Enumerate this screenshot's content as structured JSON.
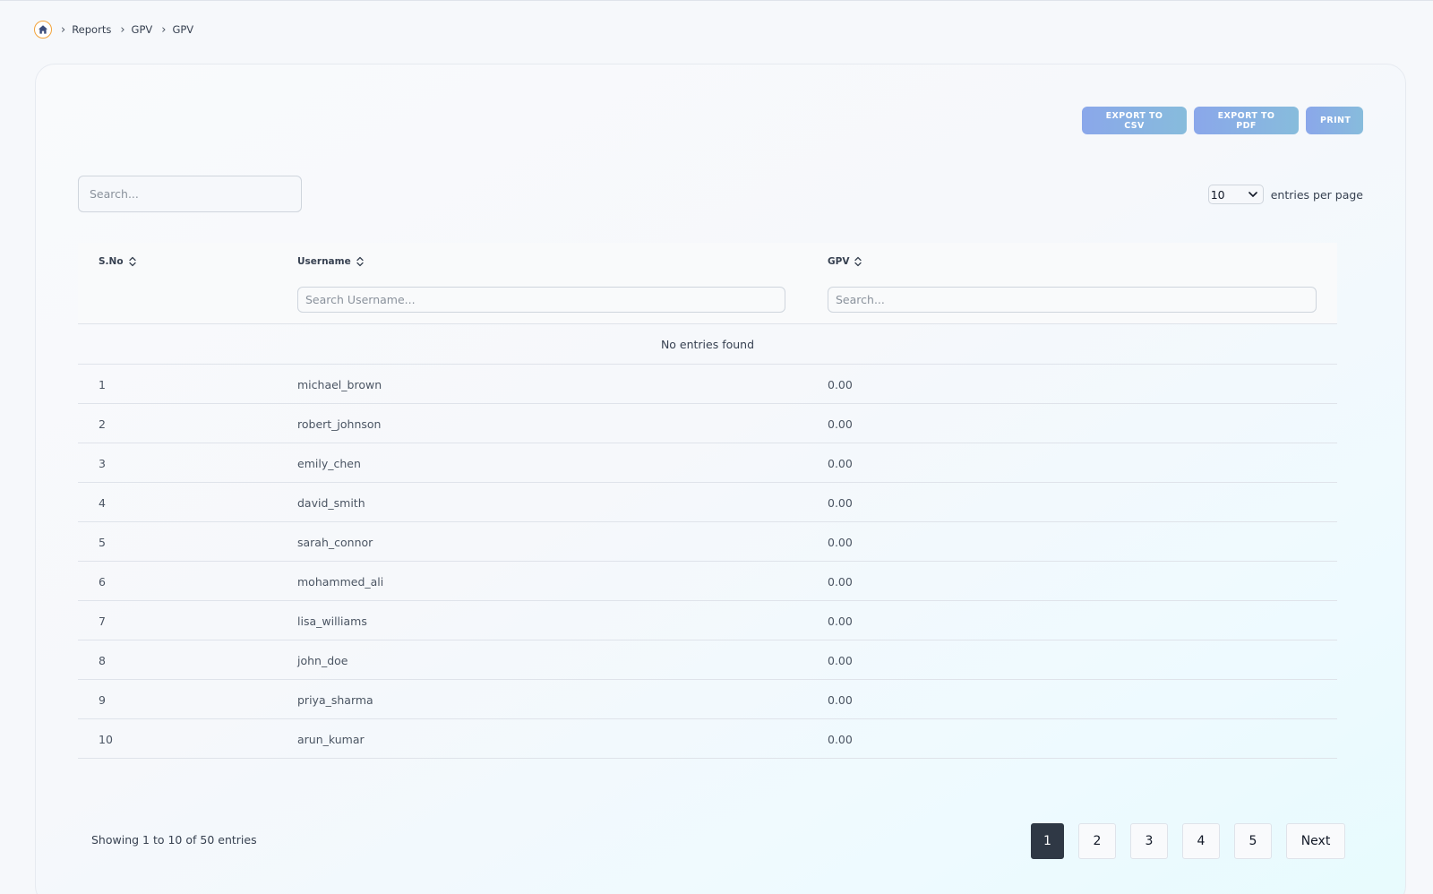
{
  "breadcrumb": {
    "items": [
      "Reports",
      "GPV",
      "GPV"
    ]
  },
  "toolbar": {
    "export_csv_label": "Export to CSV",
    "export_pdf_label": "Export to PDF",
    "print_label": "Print"
  },
  "search": {
    "placeholder": "Search..."
  },
  "entries": {
    "value": "10",
    "label": "entries per page"
  },
  "table": {
    "columns": [
      "S.No",
      "Username",
      "GPV"
    ],
    "username_filter_placeholder": "Search Username...",
    "gpv_filter_placeholder": "Search...",
    "empty_message": "No entries found",
    "rows": [
      {
        "sno": "1",
        "username": "michael_brown",
        "gpv": "0.00"
      },
      {
        "sno": "2",
        "username": "robert_johnson",
        "gpv": "0.00"
      },
      {
        "sno": "3",
        "username": "emily_chen",
        "gpv": "0.00"
      },
      {
        "sno": "4",
        "username": "david_smith",
        "gpv": "0.00"
      },
      {
        "sno": "5",
        "username": "sarah_connor",
        "gpv": "0.00"
      },
      {
        "sno": "6",
        "username": "mohammed_ali",
        "gpv": "0.00"
      },
      {
        "sno": "7",
        "username": "lisa_williams",
        "gpv": "0.00"
      },
      {
        "sno": "8",
        "username": "john_doe",
        "gpv": "0.00"
      },
      {
        "sno": "9",
        "username": "priya_sharma",
        "gpv": "0.00"
      },
      {
        "sno": "10",
        "username": "arun_kumar",
        "gpv": "0.00"
      }
    ]
  },
  "footer": {
    "showing_text": "Showing 1 to 10 of 50 entries"
  },
  "pagination": {
    "pages": [
      "1",
      "2",
      "3",
      "4",
      "5"
    ],
    "active_page": "1",
    "next_label": "Next"
  },
  "colors": {
    "accent_button": "#8aa7ea",
    "active_page": "#2f3845",
    "home_ring": "#f2a33a"
  }
}
